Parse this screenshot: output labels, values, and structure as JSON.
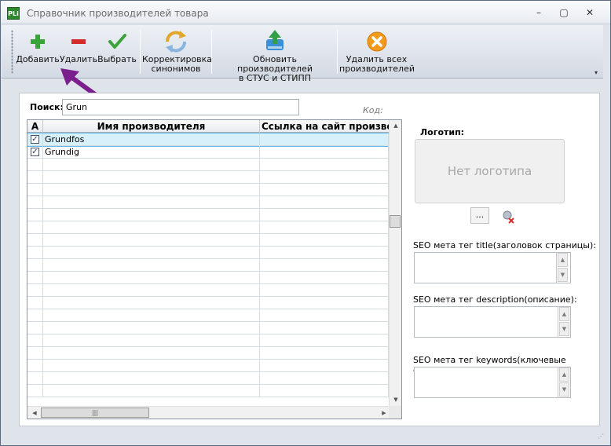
{
  "window": {
    "title": "Справочник производителей товара",
    "app_icon": "PLi",
    "minimize": "–",
    "maximize": "▢",
    "close": "✕"
  },
  "toolbar": {
    "add_label": "Добавить",
    "delete_label": "Удалить",
    "select_label": "Выбрать",
    "synonyms_label": "Корректировка\nсинонимов",
    "update_label": "Обновить производителей\nв СТУС и СТИПП",
    "delete_all_label": "Удалить всех\nпроизводителей",
    "overflow": "▾"
  },
  "search": {
    "label": "Поиск:",
    "value": "Grun"
  },
  "code_label": "Код:",
  "grid": {
    "columns": [
      "А",
      "Имя производителя",
      "Ссылка на сайт производителя"
    ],
    "rows": [
      {
        "checked": true,
        "name": "Grundfos",
        "url": ""
      },
      {
        "checked": true,
        "name": "Grundig",
        "url": ""
      }
    ],
    "empty_rows": 19
  },
  "logo": {
    "label": "Логотип:",
    "placeholder": "Нет логотипа",
    "browse_label": "..."
  },
  "seo": {
    "title_label": "SEO мета тег title(заголовок страницы):",
    "description_label": "SEO мета тег description(описание):",
    "keywords_label": "SEO мета тег keywords(ключевые слова):"
  },
  "colors": {
    "add": "#3aa33a",
    "delete": "#d42b2b",
    "select": "#3aa33a",
    "delete_all": "#f29a1c",
    "selected_row": "#d7f1fb",
    "arrow": "#7b1f8c"
  },
  "icons": {
    "add": "plus-icon",
    "delete": "minus-icon",
    "select": "checkmark-icon",
    "synonyms": "refresh-icon",
    "update": "cloud-sync-icon",
    "delete_all": "delete-circle-icon"
  }
}
